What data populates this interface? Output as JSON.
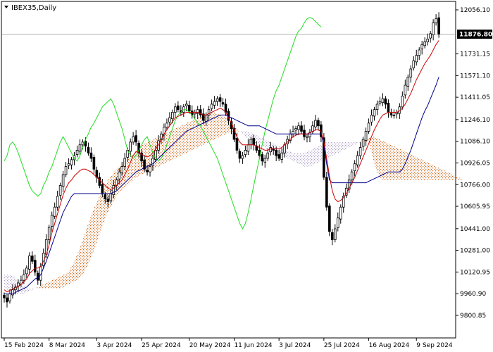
{
  "chart_data": {
    "type": "line",
    "title": "IBEX35,Daily",
    "current_price": 11876.8,
    "ylim": [
      9800.85,
      12056.1
    ],
    "y_ticks": [
      {
        "value": 12056.1,
        "label": "12056.10"
      },
      {
        "value": 11731.15,
        "label": "11731.15"
      },
      {
        "value": 11571.1,
        "label": "11571.10"
      },
      {
        "value": 11411.05,
        "label": "11411.05"
      },
      {
        "value": 11246.1,
        "label": "11246.10"
      },
      {
        "value": 11086.1,
        "label": "11086.10"
      },
      {
        "value": 10926.05,
        "label": "10926.05"
      },
      {
        "value": 10766.0,
        "label": "10766.00"
      },
      {
        "value": 10605.95,
        "label": "10605.95"
      },
      {
        "value": 10441.0,
        "label": "10441.00"
      },
      {
        "value": 10281.0,
        "label": "10281.00"
      },
      {
        "value": 10120.95,
        "label": "10120.95"
      },
      {
        "value": 9960.9,
        "label": "9960.90"
      },
      {
        "value": 9800.85,
        "label": "9800.85"
      }
    ],
    "x_ticks": [
      {
        "value": 0,
        "label": "15 Feb 2024"
      },
      {
        "value": 16,
        "label": "8 Mar 2024"
      },
      {
        "value": 33,
        "label": "3 Apr 2024"
      },
      {
        "value": 49,
        "label": "25 Apr 2024"
      },
      {
        "value": 66,
        "label": "20 May 2024"
      },
      {
        "value": 82,
        "label": "11 Jun 2024"
      },
      {
        "value": 98,
        "label": "3 Jul 2024"
      },
      {
        "value": 114,
        "label": "25 Jul 2024"
      },
      {
        "value": 130,
        "label": "16 Aug 2024"
      },
      {
        "value": 147,
        "label": "9 Sep 2024"
      }
    ],
    "x_range": [
      0,
      160
    ],
    "close": [
      9930,
      9900,
      9960,
      9990,
      10010,
      10040,
      10060,
      10100,
      10150,
      10240,
      10200,
      10120,
      10060,
      10160,
      10260,
      10360,
      10450,
      10540,
      10600,
      10680,
      10760,
      10840,
      10900,
      10920,
      10950,
      10980,
      11020,
      11060,
      11080,
      11050,
      11000,
      10960,
      10880,
      10820,
      10760,
      10700,
      10660,
      10640,
      10700,
      10760,
      10800,
      10860,
      10900,
      10960,
      11020,
      11080,
      11120,
      11080,
      11000,
      10940,
      10880,
      10860,
      10900,
      10960,
      11020,
      11090,
      11140,
      11190,
      11220,
      11260,
      11300,
      11340,
      11320,
      11300,
      11340,
      11360,
      11310,
      11280,
      11300,
      11320,
      11280,
      11240,
      11280,
      11320,
      11360,
      11380,
      11400,
      11380,
      11360,
      11300,
      11240,
      11180,
      11100,
      11020,
      10960,
      10980,
      11020,
      11060,
      11100,
      11060,
      11020,
      10980,
      10940,
      10960,
      11000,
      11040,
      11020,
      10980,
      10960,
      11000,
      11060,
      11100,
      11140,
      11160,
      11180,
      11200,
      11160,
      11120,
      11120,
      11150,
      11200,
      11240,
      11200,
      11120,
      10820,
      10600,
      10420,
      10360,
      10440,
      10520,
      10600,
      10680,
      10740,
      10800,
      10860,
      10920,
      10980,
      11040,
      11100,
      11160,
      11220,
      11280,
      11320,
      11360,
      11380,
      11400,
      11360,
      11300,
      11280,
      11280,
      11300,
      11340,
      11420,
      11500,
      11560,
      11620,
      11680,
      11720,
      11760,
      11800,
      11820,
      11840,
      11880,
      11960,
      11990,
      11876.8
    ],
    "series": [
      {
        "key": "tenkan",
        "values": [
          9990,
          9975,
          9985,
          9995,
          10005,
          10015,
          10030,
          10050,
          10070,
          10110,
          10130,
          10150,
          10150,
          10160,
          10200,
          10250,
          10320,
          10410,
          10480,
          10550,
          10620,
          10690,
          10740,
          10780,
          10800,
          10830,
          10850,
          10870,
          10880,
          10880,
          10870,
          10860,
          10840,
          10820,
          10800,
          10780,
          10760,
          10740,
          10730,
          10740,
          10760,
          10780,
          10800,
          10840,
          10880,
          10930,
          10980,
          11010,
          11000,
          10990,
          10980,
          10970,
          10980,
          11000,
          11030,
          11060,
          11100,
          11140,
          11170,
          11200,
          11230,
          11260,
          11270,
          11280,
          11290,
          11300,
          11300,
          11300,
          11300,
          11300,
          11290,
          11280,
          11280,
          11290,
          11300,
          11310,
          11320,
          11330,
          11320,
          11300,
          11260,
          11220,
          11170,
          11120,
          11080,
          11060,
          11060,
          11060,
          11060,
          11060,
          11050,
          11040,
          11030,
          11020,
          11020,
          11030,
          11030,
          11030,
          11030,
          11040,
          11060,
          11080,
          11100,
          11120,
          11130,
          11140,
          11140,
          11140,
          11140,
          11150,
          11160,
          11170,
          11170,
          11160,
          11080,
          10960,
          10830,
          10720,
          10660,
          10640,
          10650,
          10670,
          10700,
          10740,
          10780,
          10820,
          10870,
          10920,
          10970,
          11020,
          11070,
          11120,
          11170,
          11210,
          11250,
          11280,
          11290,
          11300,
          11300,
          11300,
          11300,
          11310,
          11330,
          11360,
          11400,
          11440,
          11490,
          11540,
          11580,
          11620,
          11660,
          11690,
          11720,
          11760,
          11800,
          11830
        ]
      },
      {
        "key": "kijun",
        "values": [
          9960,
          9960,
          9960,
          9960,
          9970,
          9980,
          9990,
          10000,
          10010,
          10030,
          10050,
          10070,
          10080,
          10100,
          10150,
          10200,
          10260,
          10320,
          10380,
          10440,
          10500,
          10560,
          10600,
          10640,
          10680,
          10700,
          10700,
          10700,
          10700,
          10700,
          10700,
          10700,
          10700,
          10700,
          10700,
          10700,
          10700,
          10700,
          10700,
          10710,
          10720,
          10740,
          10760,
          10780,
          10800,
          10820,
          10840,
          10860,
          10870,
          10880,
          10890,
          10900,
          10910,
          10920,
          10940,
          10960,
          10980,
          11000,
          11020,
          11040,
          11060,
          11080,
          11100,
          11120,
          11140,
          11160,
          11170,
          11180,
          11190,
          11200,
          11210,
          11220,
          11230,
          11240,
          11250,
          11260,
          11270,
          11280,
          11280,
          11280,
          11270,
          11260,
          11250,
          11240,
          11230,
          11220,
          11210,
          11200,
          11200,
          11200,
          11200,
          11200,
          11190,
          11180,
          11170,
          11160,
          11150,
          11140,
          11140,
          11140,
          11140,
          11140,
          11140,
          11140,
          11140,
          11140,
          11140,
          11140,
          11140,
          11140,
          11140,
          11140,
          11140,
          11140,
          11060,
          10920,
          10800,
          10780,
          10780,
          10780,
          10780,
          10780,
          10780,
          10780,
          10780,
          10780,
          10780,
          10780,
          10780,
          10780,
          10790,
          10800,
          10810,
          10820,
          10830,
          10840,
          10850,
          10860,
          10860,
          10860,
          10860,
          10860,
          10880,
          10920,
          10970,
          11020,
          11080,
          11140,
          11200,
          11260,
          11310,
          11350,
          11400,
          11450,
          11500,
          11560
        ]
      },
      {
        "key": "chikou",
        "values": [
          10940,
          10980,
          11060,
          11080,
          11050,
          11000,
          10940,
          10880,
          10820,
          10760,
          10720,
          10700,
          10680,
          10700,
          10760,
          10800,
          10860,
          10900,
          10960,
          11020,
          11080,
          11120,
          11080,
          11040,
          11000,
          10960,
          10940,
          10980,
          11040,
          11100,
          11140,
          11190,
          11220,
          11260,
          11300,
          11340,
          11360,
          11380,
          11400,
          11360,
          11300,
          11240,
          11180,
          11100,
          11020,
          10980,
          10960,
          10980,
          11020,
          11060,
          11100,
          11120,
          11060,
          11000,
          10960,
          10940,
          10960,
          11000,
          11060,
          11120,
          11180,
          11240,
          11280,
          11300,
          11320,
          11320,
          11300,
          11280,
          11250,
          11220,
          11200,
          11160,
          11120,
          11080,
          11040,
          11000,
          10960,
          10900,
          10840,
          10780,
          10720,
          10660,
          10600,
          10540,
          10480,
          10440,
          10480,
          10560,
          10660,
          10760,
          10860,
          10960,
          11060,
          11160,
          11240,
          11320,
          11400,
          11460,
          11500,
          11560,
          11620,
          11680,
          11740,
          11800,
          11860,
          11900,
          11920,
          11960,
          11990,
          12000,
          11990,
          11970,
          11950,
          11930
        ]
      },
      {
        "key": "span_a",
        "values": [
          10000,
          9990,
          9980,
          9970,
          9960,
          9960,
          9960,
          9960,
          9970,
          9980,
          9990,
          10000,
          10010,
          10020,
          10030,
          10040,
          10050,
          10060,
          10070,
          10080,
          10090,
          10100,
          10110,
          10130,
          10160,
          10200,
          10250,
          10300,
          10360,
          10420,
          10480,
          10540,
          10590,
          10640,
          10680,
          10720,
          10760,
          10800,
          10830,
          10860,
          10880,
          10900,
          10920,
          10940,
          10960,
          10980,
          11000,
          11020,
          11040,
          11060,
          11070,
          11080,
          11090,
          11100,
          11110,
          11120,
          11130,
          11140,
          11150,
          11160,
          11170,
          11180,
          11190,
          11200,
          11210,
          11220,
          11230,
          11240,
          11250,
          11260,
          11270,
          11280,
          11290,
          11300,
          11300,
          11300,
          11290,
          11280,
          11270,
          11260,
          11240,
          11220,
          11200,
          11180,
          11160,
          11140,
          11120,
          11100,
          11090,
          11080,
          11070,
          11060,
          11050,
          11040,
          11030,
          11020,
          11010,
          11000,
          10990,
          10980,
          10970,
          10960,
          10950,
          10940,
          10930,
          10920,
          10910,
          10900,
          10900,
          10900,
          10910,
          10920,
          10930,
          10940,
          10950,
          10960,
          10970,
          10980,
          10990,
          11000,
          11010,
          11020,
          11030,
          11040,
          11050,
          11060,
          11070,
          11080,
          11090,
          11100,
          11110,
          11120,
          11120,
          11110,
          11100,
          11090,
          11080,
          11070,
          11060,
          11050,
          11040,
          11030,
          11020,
          11010,
          11000,
          10990,
          10980,
          10970,
          10960,
          10950,
          10940,
          10930,
          10920,
          10910,
          10900,
          10890,
          10880,
          10870,
          10860,
          10850,
          10840,
          10830,
          10820,
          10810,
          10800
        ]
      },
      {
        "key": "span_b",
        "values": [
          10100,
          10100,
          10100,
          10100,
          10080,
          10060,
          10040,
          10020,
          10000,
          10000,
          10000,
          10000,
          10000,
          10000,
          10000,
          10000,
          10000,
          10000,
          10000,
          10000,
          10000,
          10010,
          10020,
          10030,
          10040,
          10050,
          10060,
          10080,
          10100,
          10140,
          10180,
          10230,
          10280,
          10340,
          10400,
          10460,
          10520,
          10560,
          10600,
          10640,
          10680,
          10700,
          10720,
          10740,
          10760,
          10780,
          10800,
          10820,
          10830,
          10840,
          10850,
          10860,
          10870,
          10880,
          10890,
          10900,
          10910,
          10920,
          10930,
          10940,
          10950,
          10960,
          10970,
          10980,
          10990,
          11000,
          11010,
          11020,
          11030,
          11040,
          11050,
          11060,
          11070,
          11080,
          11090,
          11100,
          11110,
          11120,
          11130,
          11140,
          11150,
          11160,
          11160,
          11160,
          11160,
          11160,
          11160,
          11160,
          11150,
          11140,
          11130,
          11120,
          11110,
          11100,
          11090,
          11080,
          11070,
          11060,
          11050,
          11040,
          11030,
          11020,
          11010,
          11000,
          11000,
          11000,
          11000,
          11000,
          11010,
          11020,
          11030,
          11040,
          11050,
          11060,
          11070,
          11080,
          11080,
          11080,
          11080,
          11080,
          11080,
          11080,
          11080,
          11080,
          11080,
          11080,
          11080,
          11080,
          11080,
          11080,
          11080,
          11000,
          10920,
          10860,
          10820,
          10800,
          10800,
          10800,
          10800,
          10800,
          10800,
          10800,
          10800,
          10800,
          10800,
          10800,
          10800,
          10800,
          10800,
          10800,
          10800,
          10800,
          10800,
          10800,
          10800,
          10800,
          10800,
          10800,
          10800,
          10800,
          10800,
          10800,
          10800,
          10800,
          10800
        ]
      }
    ],
    "colors": {
      "tenkan": "#cc0000",
      "kijun": "#00008b",
      "chikou": "#22dd22",
      "cloud_bull": "#d2691e",
      "cloud_bear": "#b09ec8",
      "candle": "#000000",
      "price_line": "#b0b0b0",
      "price_tag_bg": "#000000"
    }
  }
}
